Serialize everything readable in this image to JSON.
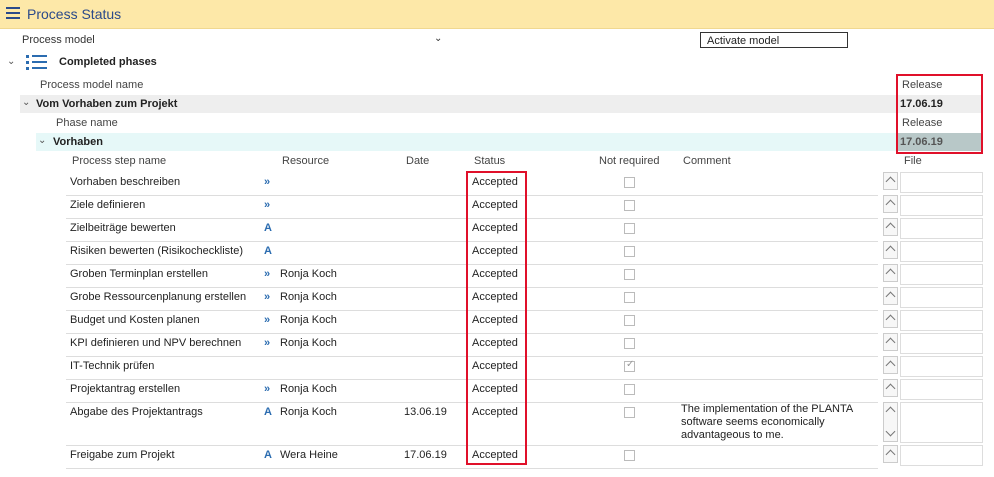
{
  "header": {
    "title": "Process Status"
  },
  "process_model": {
    "label": "Process model",
    "activate_label": "Activate model"
  },
  "completed_phases": {
    "label": "Completed phases"
  },
  "model_header": {
    "name_label": "Process model name",
    "release_label": "Release"
  },
  "model_row": {
    "name": "Vom Vorhaben zum Projekt",
    "release_date": "17.06.19"
  },
  "phase_header": {
    "name_label": "Phase name",
    "release_label": "Release"
  },
  "phase_row": {
    "name": "Vorhaben",
    "release_date": "17.06.19"
  },
  "columns": {
    "step_name": "Process step name",
    "resource": "Resource",
    "date": "Date",
    "status": "Status",
    "not_required": "Not required",
    "comment": "Comment",
    "file": "File"
  },
  "steps": [
    {
      "name": "Vorhaben beschreiben",
      "icon": "»",
      "resource": "",
      "date": "",
      "status": "Accepted",
      "not_required": false,
      "comment": ""
    },
    {
      "name": "Ziele definieren",
      "icon": "»",
      "resource": "",
      "date": "",
      "status": "Accepted",
      "not_required": false,
      "comment": ""
    },
    {
      "name": "Zielbeiträge bewerten",
      "icon": "A",
      "resource": "",
      "date": "",
      "status": "Accepted",
      "not_required": false,
      "comment": ""
    },
    {
      "name": "Risiken bewerten (Risikocheckliste)",
      "icon": "A",
      "resource": "",
      "date": "",
      "status": "Accepted",
      "not_required": false,
      "comment": ""
    },
    {
      "name": "Groben Terminplan erstellen",
      "icon": "»",
      "resource": "Ronja Koch",
      "date": "",
      "status": "Accepted",
      "not_required": false,
      "comment": ""
    },
    {
      "name": "Grobe Ressourcenplanung erstellen",
      "icon": "»",
      "resource": "Ronja Koch",
      "date": "",
      "status": "Accepted",
      "not_required": false,
      "comment": ""
    },
    {
      "name": "Budget und Kosten planen",
      "icon": "»",
      "resource": "Ronja Koch",
      "date": "",
      "status": "Accepted",
      "not_required": false,
      "comment": ""
    },
    {
      "name": "KPI definieren und NPV berechnen",
      "icon": "»",
      "resource": "Ronja Koch",
      "date": "",
      "status": "Accepted",
      "not_required": false,
      "comment": ""
    },
    {
      "name": "IT-Technik prüfen",
      "icon": "",
      "resource": "",
      "date": "",
      "status": "Accepted",
      "not_required": true,
      "comment": ""
    },
    {
      "name": "Projektantrag erstellen",
      "icon": "»",
      "resource": "Ronja Koch",
      "date": "",
      "status": "Accepted",
      "not_required": false,
      "comment": ""
    },
    {
      "name": "Abgabe des Projektantrags",
      "icon": "A",
      "resource": "Ronja Koch",
      "date": "13.06.19",
      "status": "Accepted",
      "not_required": false,
      "comment": "The implementation of the PLANTA software seems economically advantageous to me."
    },
    {
      "name": "Freigabe zum Projekt",
      "icon": "A",
      "resource": "Wera Heine",
      "date": "17.06.19",
      "status": "Accepted",
      "not_required": false,
      "comment": ""
    }
  ],
  "colors": {
    "header_bg": "#fde8a8",
    "accent": "#2b4a8a",
    "phase_bg": "#e6f8f8",
    "highlight": "#e0102a"
  }
}
